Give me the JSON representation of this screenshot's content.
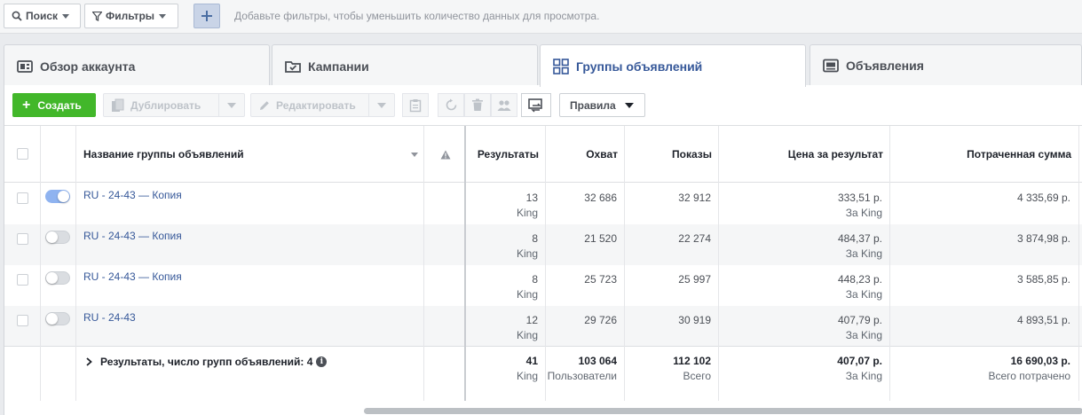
{
  "filterbar": {
    "search_label": "Поиск",
    "filters_label": "Фильтры",
    "hint": "Добавьте фильтры, чтобы уменьшить количество данных для просмотра."
  },
  "tabs": [
    {
      "label": "Обзор аккаунта",
      "icon": "account-overview-icon",
      "active": false
    },
    {
      "label": "Кампании",
      "icon": "folder-check-icon",
      "active": false
    },
    {
      "label": "Группы объявлений",
      "icon": "grid-icon",
      "active": true
    },
    {
      "label": "Объявления",
      "icon": "ad-icon",
      "active": false
    }
  ],
  "toolbar": {
    "create_label": "Создать",
    "duplicate_label": "Дублировать",
    "edit_label": "Редактировать",
    "rules_label": "Правила"
  },
  "colors": {
    "accent": "#365899",
    "create": "#42b72a",
    "toggle_on": "#8fb3f0"
  },
  "table": {
    "headers": {
      "name": "Название группы объявлений",
      "results": "Результаты",
      "reach": "Охват",
      "impressions": "Показы",
      "cost_per_result": "Цена за результат",
      "spent": "Потраченная сумма"
    },
    "rows": [
      {
        "name": "RU - 24-43 — Копия",
        "on": true,
        "results": "13",
        "results_sub": "King",
        "reach": "32 686",
        "impressions": "32 912",
        "cost": "333,51 р.",
        "cost_sub": "За King",
        "spent": "4 335,69 р."
      },
      {
        "name": "RU - 24-43 — Копия",
        "on": false,
        "results": "8",
        "results_sub": "King",
        "reach": "21 520",
        "impressions": "22 274",
        "cost": "484,37 р.",
        "cost_sub": "За King",
        "spent": "3 874,98 р."
      },
      {
        "name": "RU - 24-43 — Копия",
        "on": false,
        "results": "8",
        "results_sub": "King",
        "reach": "25 723",
        "impressions": "25 997",
        "cost": "448,23 р.",
        "cost_sub": "За King",
        "spent": "3 585,85 р."
      },
      {
        "name": "RU - 24-43",
        "on": false,
        "results": "12",
        "results_sub": "King",
        "reach": "29 726",
        "impressions": "30 919",
        "cost": "407,79 р.",
        "cost_sub": "За King",
        "spent": "4 893,51 р."
      }
    ],
    "totals": {
      "label": "Результаты, число групп объявлений: 4",
      "results": "41",
      "results_sub": "King",
      "reach": "103 064",
      "reach_sub": "Пользователи",
      "impressions": "112 102",
      "impressions_sub": "Всего",
      "cost": "407,07 р.",
      "cost_sub": "За King",
      "spent": "16 690,03 р.",
      "spent_sub": "Всего потрачено"
    }
  }
}
